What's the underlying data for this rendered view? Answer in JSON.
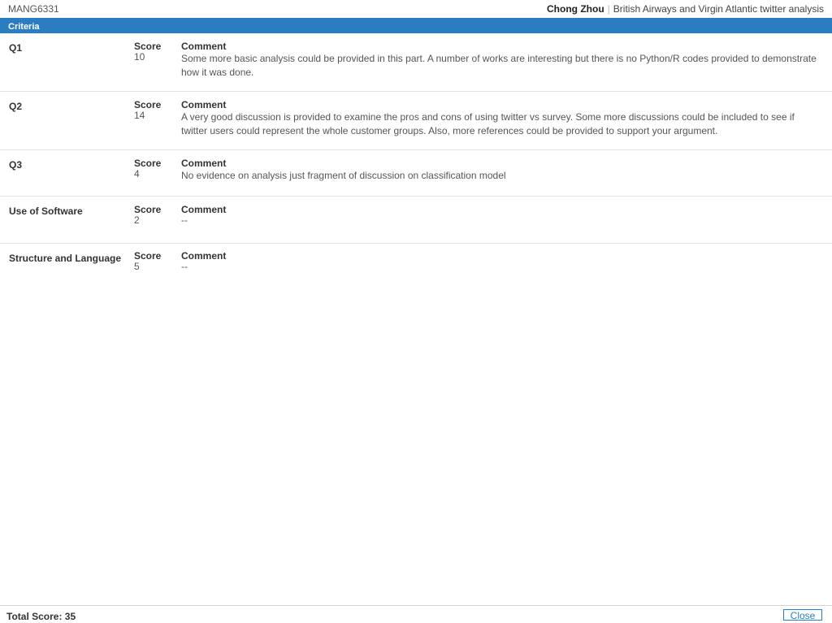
{
  "header": {
    "course_code": "MANG6331",
    "student_name": "Chong Zhou",
    "separator": "|",
    "assignment_title": "British Airways and Virgin Atlantic twitter analysis"
  },
  "criteria_label": "Criteria",
  "labels": {
    "score": "Score",
    "comment": "Comment"
  },
  "criteria": [
    {
      "name": "Q1",
      "score": "10",
      "comment": "Some more basic analysis could be provided in this part. A number of works are interesting but there is no Python/R codes provided to demonstrate how it was done."
    },
    {
      "name": "Q2",
      "score": "14",
      "comment": "A very good discussion is provided to examine the pros and cons of using twitter vs survey. Some more discussions could be included to see if twitter users could represent the whole customer groups. Also, more references could be provided to support your argument."
    },
    {
      "name": "Q3",
      "score": "4",
      "comment": "No evidence on analysis just fragment of discussion on classification model"
    },
    {
      "name": "Use of Software",
      "score": "2",
      "comment": "--"
    },
    {
      "name": "Structure and Language",
      "score": "5",
      "comment": "--"
    }
  ],
  "footer": {
    "total_label": "Total Score: 35",
    "close_label": "Close"
  },
  "colors": {
    "accent": "#2a7dc1"
  }
}
